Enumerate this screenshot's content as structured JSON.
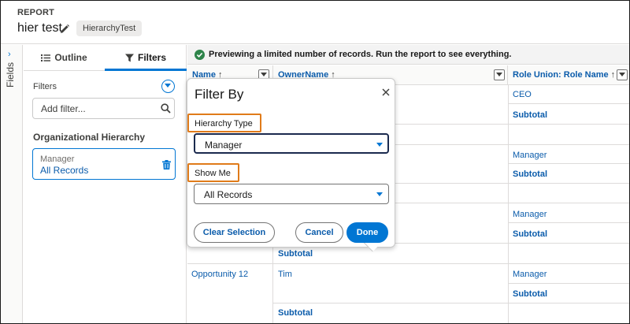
{
  "header": {
    "section_label": "REPORT",
    "title": "hier test",
    "badge": "HierarchyTest"
  },
  "fields_rail": {
    "label": "Fields"
  },
  "left_panel": {
    "tabs": [
      {
        "label": "Outline",
        "icon": "list-icon",
        "selected": false
      },
      {
        "label": "Filters",
        "icon": "filter-icon",
        "selected": true
      }
    ],
    "filters_heading": "Filters",
    "add_filter_placeholder": "Add filter...",
    "org_heading": "Organizational Hierarchy",
    "filter_card": {
      "label": "Manager",
      "value": "All Records"
    }
  },
  "report": {
    "preview_message": "Previewing a limited number of records. Run the report to see everything.",
    "columns": [
      {
        "label": "Name",
        "sort": "↑"
      },
      {
        "label": "OwnerName",
        "sort": "↑"
      },
      {
        "label": "Role Union: Role Name",
        "sort": "↑"
      }
    ],
    "role_cells": [
      "CEO",
      "Manager",
      "Manager",
      "Manager"
    ],
    "subtotal_label": "Subtotal",
    "last_group": {
      "name": "Opportunity 12",
      "owner": "Tim"
    }
  },
  "popover": {
    "title": "Filter By",
    "hierarchy_type_label": "Hierarchy Type",
    "hierarchy_type_value": "Manager",
    "show_me_label": "Show Me",
    "show_me_value": "All Records",
    "clear_label": "Clear Selection",
    "cancel_label": "Cancel",
    "done_label": "Done"
  },
  "colors": {
    "brand": "#0176d3",
    "link": "#0b5cab",
    "highlight": "#e07b1a",
    "success": "#2e844a"
  }
}
